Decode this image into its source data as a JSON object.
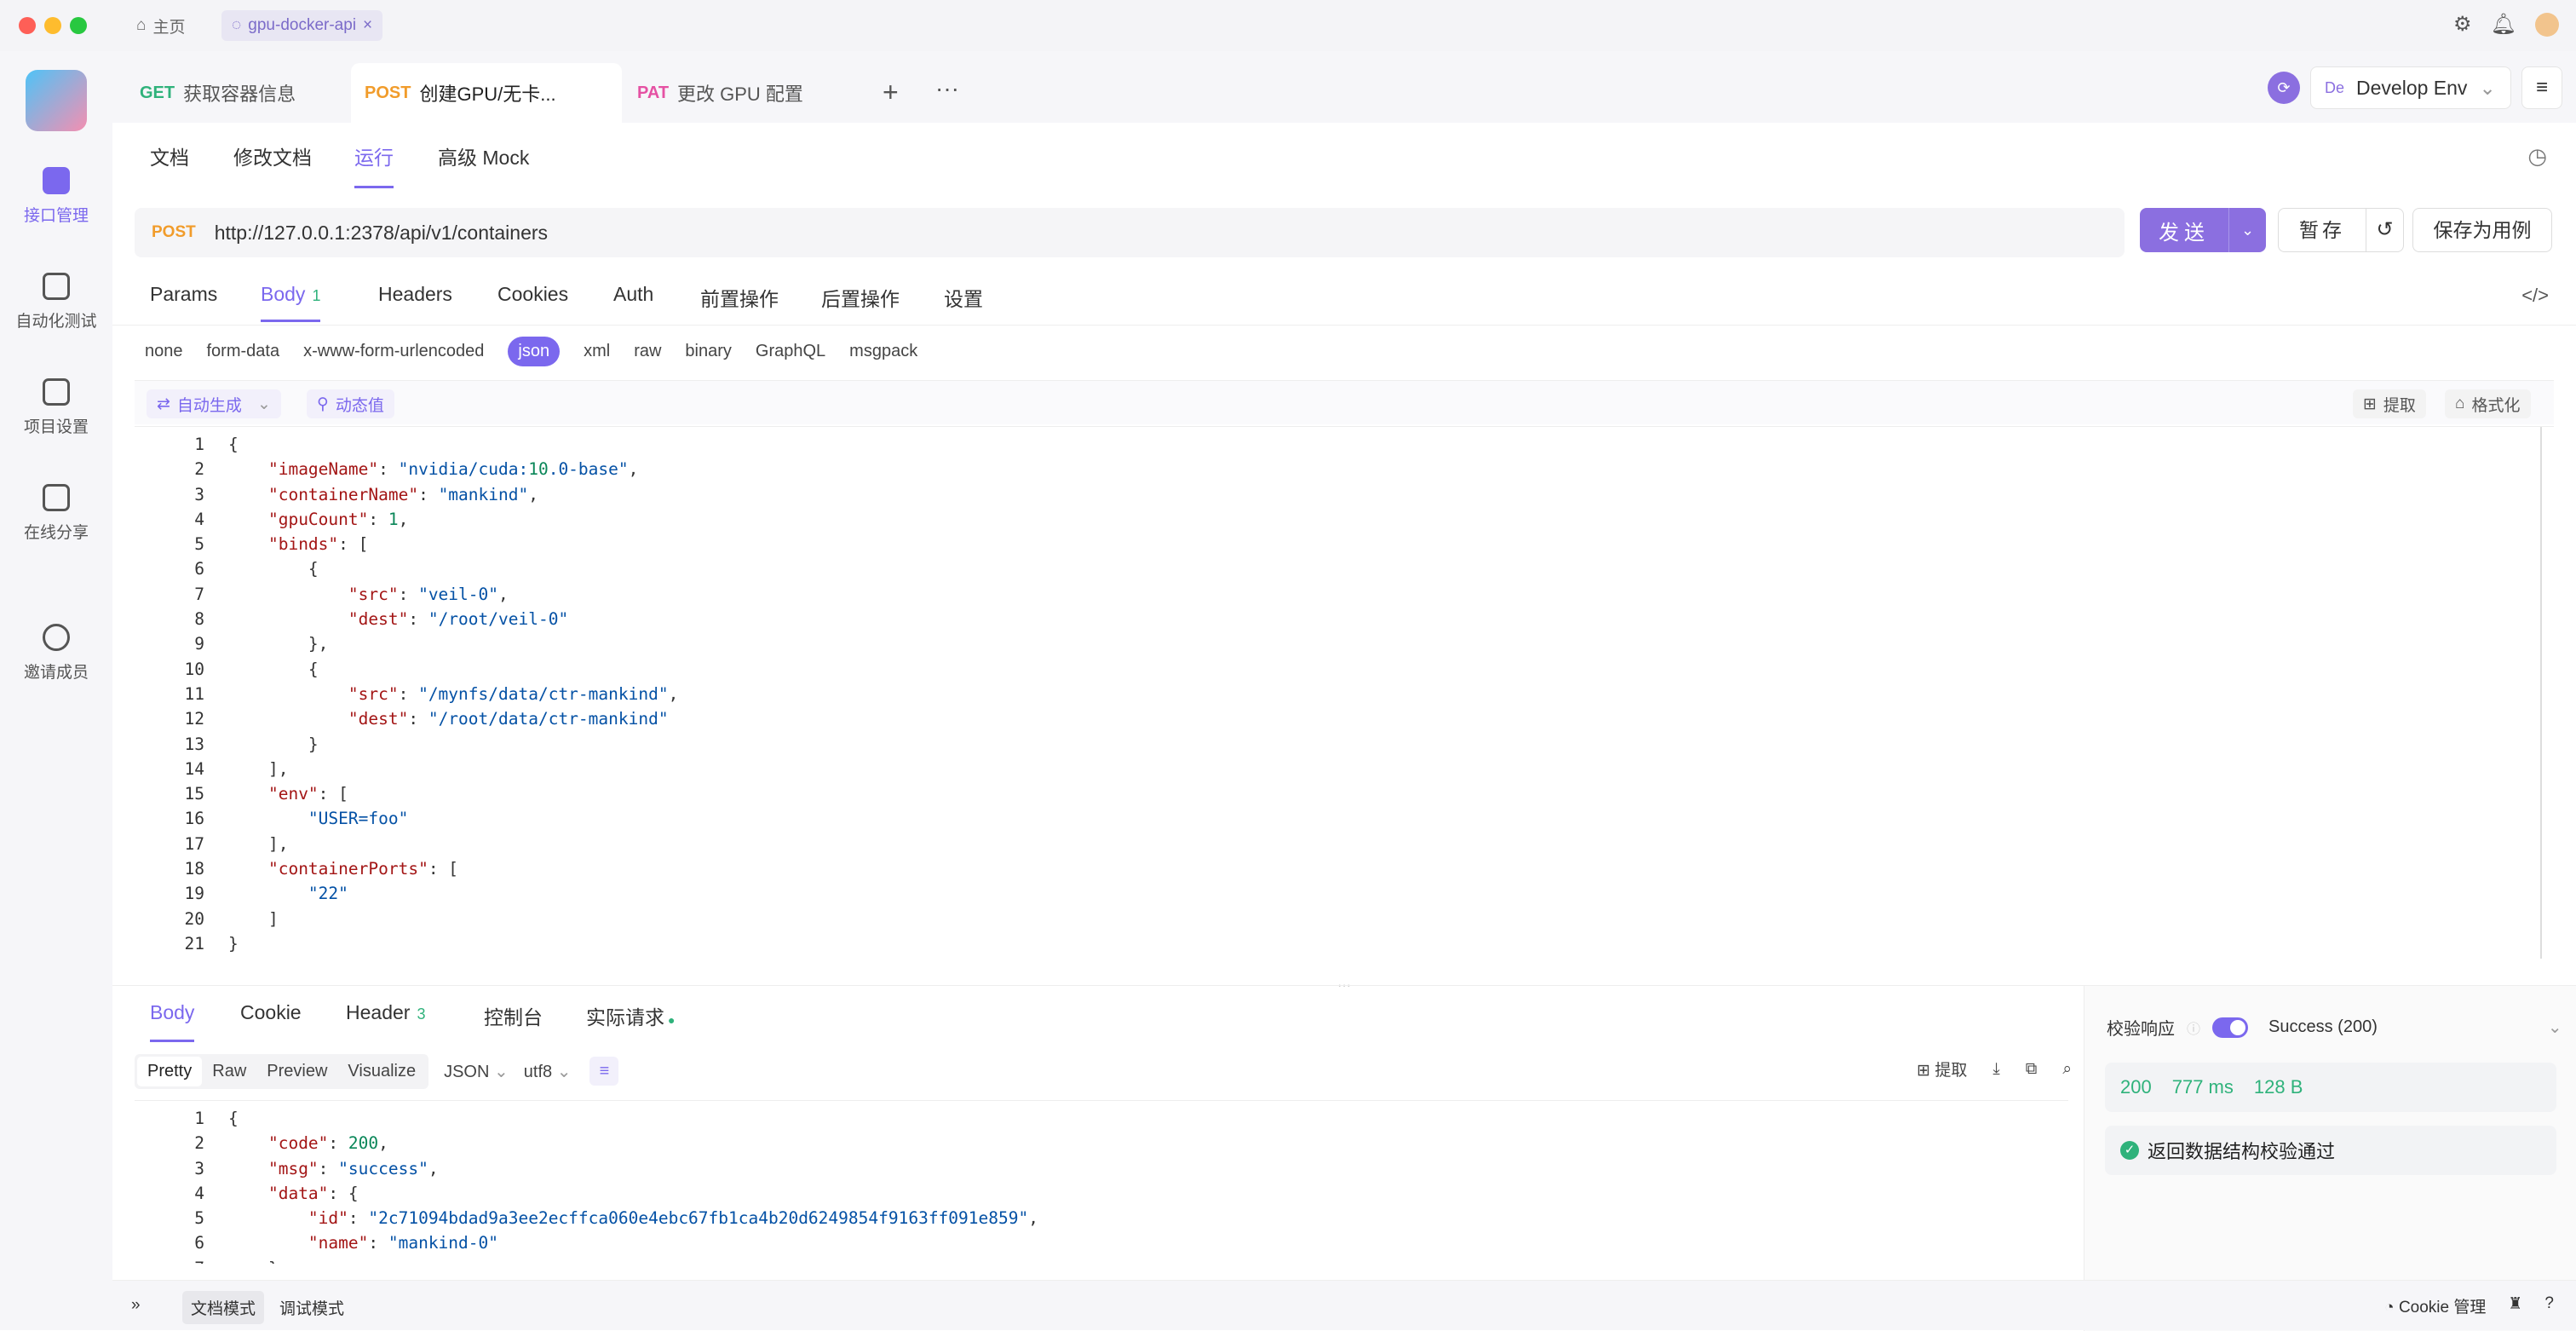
{
  "window": {
    "home_tab": "主页",
    "project_tab": "gpu-docker-api"
  },
  "sidebar": {
    "items": [
      {
        "label": "接口管理",
        "icon": "api-icon"
      },
      {
        "label": "自动化测试",
        "icon": "automation-icon"
      },
      {
        "label": "项目设置",
        "icon": "settings-icon"
      },
      {
        "label": "在线分享",
        "icon": "share-icon"
      },
      {
        "label": "邀请成员",
        "icon": "invite-icon"
      }
    ]
  },
  "request_tabs": [
    {
      "method": "GET",
      "label": "获取容器信息"
    },
    {
      "method": "POST",
      "label": "创建GPU/无卡..."
    },
    {
      "method": "PAT",
      "label": "更改 GPU 配置"
    }
  ],
  "env": {
    "badge": "De",
    "label": "Develop Env"
  },
  "doc_tabs": [
    "文档",
    "修改文档",
    "运行",
    "高级 Mock"
  ],
  "url_bar": {
    "method": "POST",
    "url": "http://127.0.0.1:2378/api/v1/containers"
  },
  "actions": {
    "send": "发送",
    "save": "暂存",
    "save_as": "保存为用例"
  },
  "param_tabs": [
    "Params",
    "Body",
    "Headers",
    "Cookies",
    "Auth",
    "前置操作",
    "后置操作",
    "设置"
  ],
  "body_count": "1",
  "body_types": [
    "none",
    "form-data",
    "x-www-form-urlencoded",
    "json",
    "xml",
    "raw",
    "binary",
    "GraphQL",
    "msgpack"
  ],
  "editor_toolbar": {
    "auto_gen": "自动生成",
    "dynamic": "动态值",
    "extract": "提取",
    "format": "格式化"
  },
  "request_body_lines": [
    "{",
    "    \"imageName\": \"nvidia/cuda:10.0-base\",",
    "    \"containerName\": \"mankind\",",
    "    \"gpuCount\": 1,",
    "    \"binds\": [",
    "        {",
    "            \"src\": \"veil-0\",",
    "            \"dest\": \"/root/veil-0\"",
    "        },",
    "        {",
    "            \"src\": \"/mynfs/data/ctr-mankind\",",
    "            \"dest\": \"/root/data/ctr-mankind\"",
    "        }",
    "    ],",
    "    \"env\": [",
    "        \"USER=foo\"",
    "    ],",
    "    \"containerPorts\": [",
    "        \"22\"",
    "    ]",
    "}"
  ],
  "response_tabs": {
    "body": "Body",
    "cookie": "Cookie",
    "header": "Header",
    "header_count": "3",
    "console": "控制台",
    "actual": "实际请求"
  },
  "view_modes": [
    "Pretty",
    "Raw",
    "Preview",
    "Visualize"
  ],
  "view_format": "JSON",
  "view_encoding": "utf8",
  "response_extract": "提取",
  "response_body_lines": [
    "{",
    "    \"code\": 200,",
    "    \"msg\": \"success\",",
    "    \"data\": {",
    "        \"id\": \"2c71094bdad9a3ee2ecffca060e4ebc67fb1ca4b20d6249854f9163ff091e859\",",
    "        \"name\": \"mankind-0\"",
    "    }"
  ],
  "validation": {
    "label": "校验响应",
    "status": "Success (200)",
    "code": "200",
    "time": "777 ms",
    "size": "128 B",
    "message": "返回数据结构校验通过"
  },
  "status_bar": {
    "doc_mode": "文档模式",
    "debug_mode": "调试模式",
    "cookie": "Cookie 管理"
  }
}
